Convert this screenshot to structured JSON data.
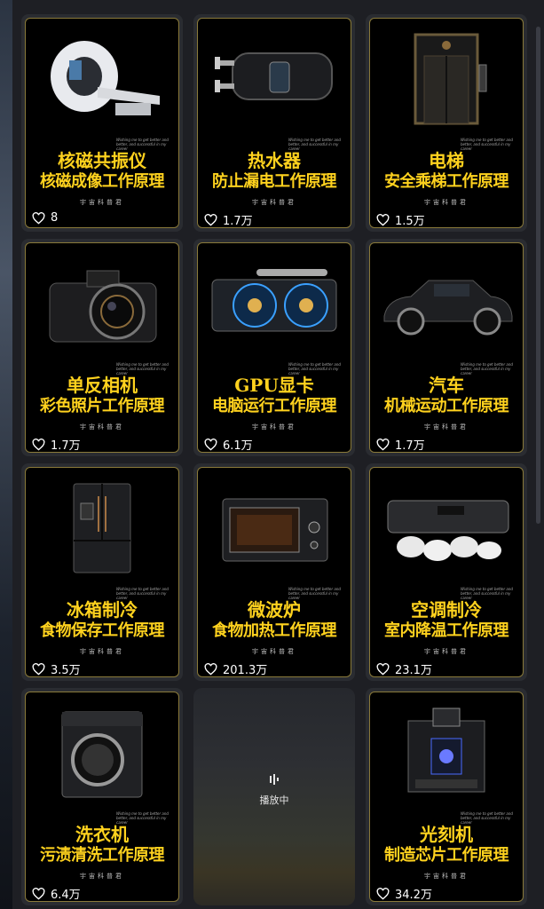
{
  "cards": [
    {
      "title": "核磁共振仪",
      "subtitle": "核磁成像工作原理",
      "likes": "8",
      "tagline": "Wishing me to get better and better, and successful in my career",
      "brand": "宇宙科普君",
      "image_icon": "mri-scanner-icon"
    },
    {
      "title": "热水器",
      "subtitle": "防止漏电工作原理",
      "likes": "1.7万",
      "tagline": "Wishing me to get better and better, and successful in my career",
      "brand": "宇宙科普君",
      "image_icon": "water-heater-icon"
    },
    {
      "title": "电梯",
      "subtitle": "安全乘梯工作原理",
      "likes": "1.5万",
      "tagline": "Wishing me to get better and better, and successful in my career",
      "brand": "宇宙科普君",
      "image_icon": "elevator-icon"
    },
    {
      "title": "单反相机",
      "subtitle": "彩色照片工作原理",
      "likes": "1.7万",
      "tagline": "Wishing me to get better and better, and successful in my career",
      "brand": "宇宙科普君",
      "image_icon": "camera-icon"
    },
    {
      "title": "GPU显卡",
      "subtitle": "电脑运行工作原理",
      "likes": "6.1万",
      "tagline": "Wishing me to get better and better, and successful in my career",
      "brand": "宇宙科普君",
      "image_icon": "gpu-card-icon"
    },
    {
      "title": "汽车",
      "subtitle": "机械运动工作原理",
      "likes": "1.7万",
      "tagline": "Wishing me to get better and better, and successful in my career",
      "brand": "宇宙科普君",
      "image_icon": "car-icon"
    },
    {
      "title": "冰箱制冷",
      "subtitle": "食物保存工作原理",
      "likes": "3.5万",
      "tagline": "Wishing me to get better and better, and successful in my career",
      "brand": "宇宙科普君",
      "image_icon": "refrigerator-icon"
    },
    {
      "title": "微波炉",
      "subtitle": "食物加热工作原理",
      "likes": "201.3万",
      "tagline": "Wishing me to get better and better, and successful in my career",
      "brand": "宇宙科普君",
      "image_icon": "microwave-icon"
    },
    {
      "title": "空调制冷",
      "subtitle": "室内降温工作原理",
      "likes": "23.1万",
      "tagline": "Wishing me to get better and better, and successful in my career",
      "brand": "宇宙科普君",
      "image_icon": "air-conditioner-icon"
    },
    {
      "title": "洗衣机",
      "subtitle": "污渍清洗工作原理",
      "likes": "6.4万",
      "tagline": "Wishing me to get better and better, and successful in my career",
      "brand": "宇宙科普君",
      "image_icon": "washing-machine-icon"
    },
    {
      "playing": true,
      "status_label": "播放中",
      "icon": "playing-bars-icon"
    },
    {
      "title": "光刻机",
      "subtitle": "制造芯片工作原理",
      "likes": "34.2万",
      "tagline": "Wishing me to get better and better, and successful in my career",
      "brand": "宇宙科普君",
      "image_icon": "lithography-machine-icon"
    }
  ],
  "colors": {
    "title": "#ffd21e",
    "card_border": "#8a7a3a",
    "background": "#1e1f24"
  }
}
